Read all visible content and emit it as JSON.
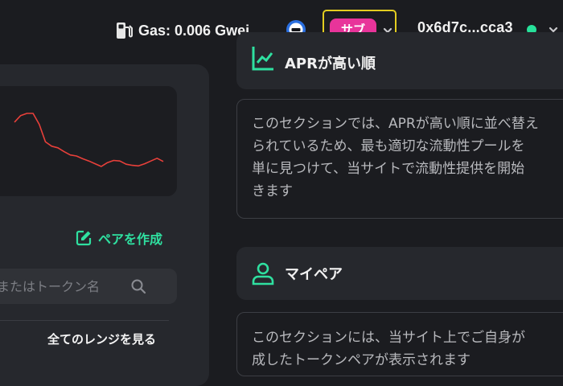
{
  "header": {
    "gas_label": "Gas: 0.006 Gwei",
    "gas_icon": "gas-pump-icon",
    "network_icon": "network-minus-icon",
    "network_badge": "サブ",
    "wallet_address": "0x6d7c...cca3",
    "wallet_status_color": "#27e19a"
  },
  "left": {
    "create_pair_label": "ペアを作成",
    "search_placeholder": "号またはトークン名",
    "see_all_ranges_label": "全てのレンジを見る"
  },
  "chart_data": {
    "type": "line",
    "title": "",
    "xlabel": "",
    "ylabel": "",
    "series": [
      {
        "values": [
          84,
          96,
          100,
          100,
          80,
          48,
          40,
          37,
          30,
          24,
          22,
          17,
          13,
          8,
          3,
          10,
          14,
          13,
          7,
          5,
          4,
          8,
          13,
          18,
          12
        ]
      }
    ],
    "ylim": [
      0,
      100
    ],
    "grid": false,
    "line_color": "#e8403a"
  },
  "right": {
    "apr_section_title": "APRが高い順",
    "apr_description": "このセクションでは、APRが高い順に並べ替え\nられているため、最も適切な流動性プールを\n単に見つけて、当サイトで流動性提供を開始\nきます",
    "my_pairs_title": "マイペア",
    "my_pairs_description": "このセクションには、当サイト上でご自身が\n成したトークンペアが表示されます"
  }
}
